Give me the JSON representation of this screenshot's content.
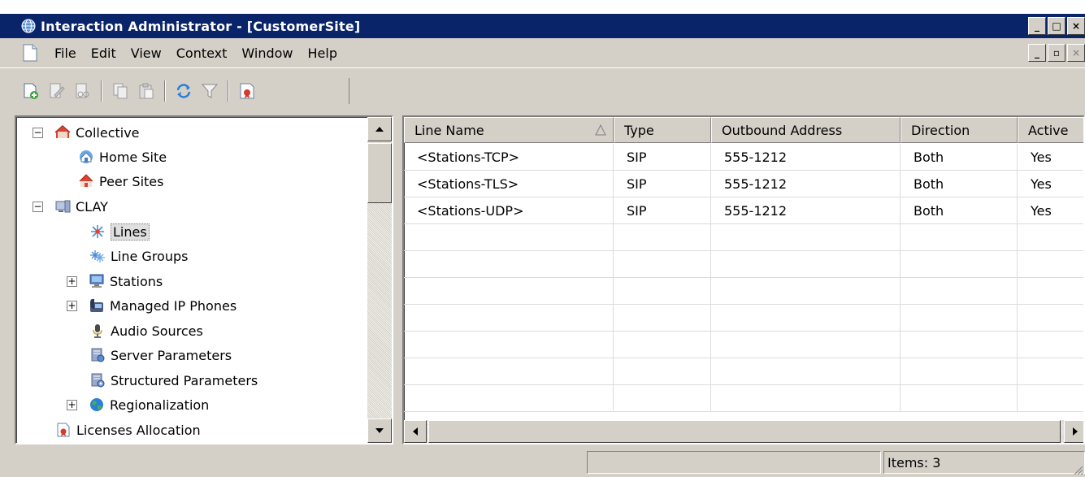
{
  "window": {
    "title": "Interaction Administrator - [CustomerSite]",
    "buttons": {
      "minimize": "_",
      "maximize": "□",
      "close": "×"
    }
  },
  "menu": {
    "items": [
      "File",
      "Edit",
      "View",
      "Context",
      "Window",
      "Help"
    ],
    "mdi_buttons": {
      "minimize": "_",
      "restore": "▫",
      "close": "×"
    }
  },
  "toolbar": {
    "buttons": [
      {
        "icon": "new-icon"
      },
      {
        "icon": "edit-icon"
      },
      {
        "icon": "cut-icon"
      },
      {
        "icon": "copy-icon"
      },
      {
        "icon": "paste-icon"
      },
      {
        "icon": "refresh-icon"
      },
      {
        "icon": "filter-icon"
      },
      {
        "icon": "license-icon"
      }
    ]
  },
  "tree": {
    "items": [
      {
        "label": "Collective",
        "icon": "collective-icon",
        "expander": "−",
        "level": 0
      },
      {
        "label": "Home Site",
        "icon": "home-site-icon",
        "level": 1
      },
      {
        "label": "Peer Sites",
        "icon": "peer-sites-icon",
        "level": 1
      },
      {
        "label": "CLAY",
        "icon": "server-icon",
        "expander": "−",
        "level": 0
      },
      {
        "label": "Lines",
        "icon": "lines-icon",
        "level": 1,
        "selected": true
      },
      {
        "label": "Line Groups",
        "icon": "line-groups-icon",
        "level": 1
      },
      {
        "label": "Stations",
        "icon": "stations-icon",
        "expander": "+",
        "level": 1
      },
      {
        "label": "Managed IP Phones",
        "icon": "phone-icon",
        "expander": "+",
        "level": 1
      },
      {
        "label": "Audio Sources",
        "icon": "microphone-icon",
        "level": 1
      },
      {
        "label": "Server Parameters",
        "icon": "server-parameters-icon",
        "level": 1
      },
      {
        "label": "Structured Parameters",
        "icon": "structured-parameters-icon",
        "level": 1
      },
      {
        "label": "Regionalization",
        "icon": "globe-icon",
        "expander": "+",
        "level": 1
      },
      {
        "label": "Licenses Allocation",
        "icon": "license-icon",
        "level": 0
      }
    ]
  },
  "grid": {
    "columns": [
      "Line Name",
      "Type",
      "Outbound Address",
      "Direction",
      "Active"
    ],
    "sort_column": "Line Name",
    "rows": [
      [
        "<Stations-TCP>",
        "SIP",
        "555-1212",
        "Both",
        "Yes"
      ],
      [
        "<Stations-TLS>",
        "SIP",
        "555-1212",
        "Both",
        "Yes"
      ],
      [
        "<Stations-UDP>",
        "SIP",
        "555-1212",
        "Both",
        "Yes"
      ]
    ]
  },
  "status": {
    "items_text": "Items: 3"
  },
  "colors": {
    "title_bar": "#0a246a",
    "chrome": "#d4d0c8"
  }
}
